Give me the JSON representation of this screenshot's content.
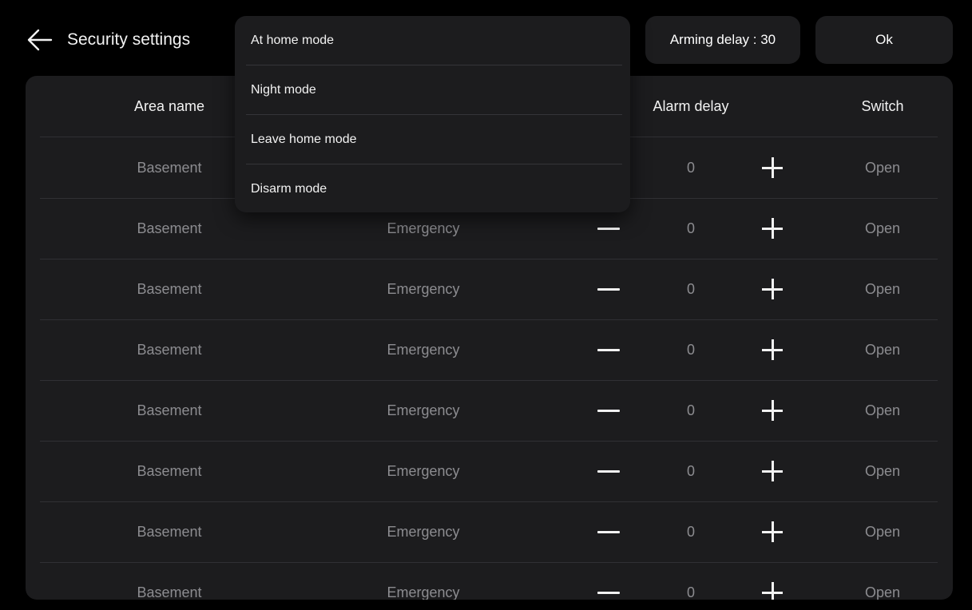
{
  "header": {
    "title": "Security settings",
    "arming_delay_label": "Arming delay : 30",
    "ok_label": "Ok"
  },
  "table": {
    "columns": {
      "area_name": "Area name",
      "alarm_delay": "Alarm delay",
      "switch": "Switch"
    },
    "rows": [
      {
        "area": "Basement",
        "type": "",
        "delay": "0",
        "switch": "Open"
      },
      {
        "area": "Basement",
        "type": "Emergency",
        "delay": "0",
        "switch": "Open"
      },
      {
        "area": "Basement",
        "type": "Emergency",
        "delay": "0",
        "switch": "Open"
      },
      {
        "area": "Basement",
        "type": "Emergency",
        "delay": "0",
        "switch": "Open"
      },
      {
        "area": "Basement",
        "type": "Emergency",
        "delay": "0",
        "switch": "Open"
      },
      {
        "area": "Basement",
        "type": "Emergency",
        "delay": "0",
        "switch": "Open"
      },
      {
        "area": "Basement",
        "type": "Emergency",
        "delay": "0",
        "switch": "Open"
      },
      {
        "area": "Basement",
        "type": "Emergency",
        "delay": "0",
        "switch": "Open"
      }
    ]
  },
  "mode_menu": {
    "items": [
      "At home mode",
      "Night mode",
      "Leave home mode",
      "Disarm mode"
    ]
  },
  "colors": {
    "background": "#000000",
    "surface": "#1c1c1e",
    "text_primary": "#f2f2f2",
    "text_muted": "#8c8c90"
  },
  "icons": {
    "back": "arrow-left-icon",
    "decrease": "minus-icon",
    "increase": "plus-icon"
  }
}
